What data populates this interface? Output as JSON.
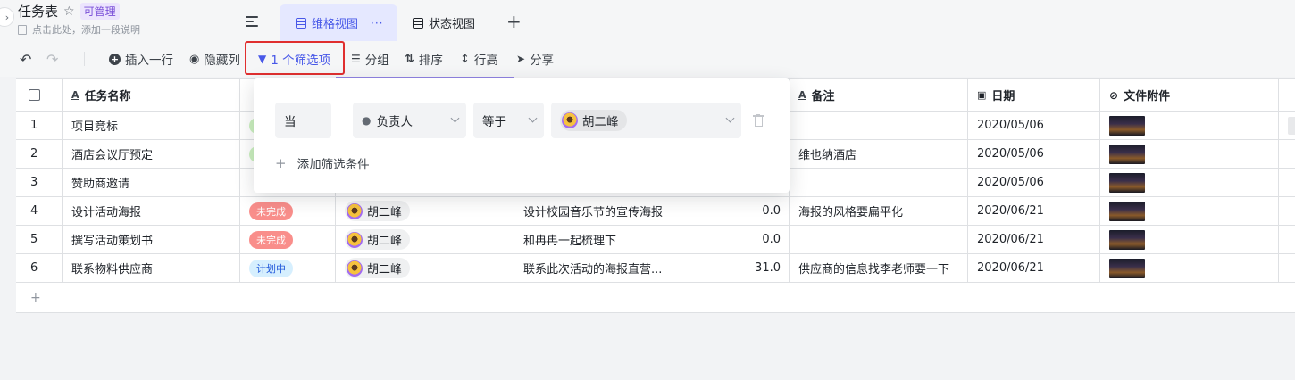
{
  "header": {
    "title": "任务表",
    "badge": "可管理",
    "description": "点击此处，添加一段说明",
    "views": [
      {
        "label": "维格视图",
        "active": true,
        "icon": "grid-icon",
        "more": "···"
      },
      {
        "label": "状态视图",
        "active": false,
        "icon": "grid-icon"
      }
    ],
    "add_view": "+"
  },
  "toolbar": {
    "undo": "↶",
    "redo": "↷",
    "insert_row": "插入一行",
    "hide_col": "隐藏列",
    "filter": "1 个筛选项",
    "group": "分组",
    "sort": "排序",
    "row_height": "行高",
    "share": "分享"
  },
  "table": {
    "columns": {
      "name": "任务名称",
      "note": "备注",
      "date": "日期",
      "attachment": "文件附件"
    },
    "rows": [
      {
        "num": "1",
        "name": "项目竞标",
        "status": "",
        "status_color": "green",
        "person": "",
        "desc": "",
        "amount": "",
        "note": "",
        "date": "2020/05/06"
      },
      {
        "num": "2",
        "name": "酒店会议厅预定",
        "status": "",
        "status_color": "green",
        "person": "",
        "desc": "",
        "amount": "",
        "note": "维也纳酒店",
        "date": "2020/05/06"
      },
      {
        "num": "3",
        "name": "赞助商邀请",
        "status": "",
        "status_color": "",
        "person": "",
        "desc": "",
        "amount": "",
        "note": "",
        "date": "2020/05/06"
      },
      {
        "num": "4",
        "name": "设计活动海报",
        "status": "未完成",
        "status_color": "red",
        "person": "胡二峰",
        "desc": "设计校园音乐节的宣传海报",
        "amount": "0.0",
        "note": "海报的风格要扁平化",
        "date": "2020/06/21"
      },
      {
        "num": "5",
        "name": "撰写活动策划书",
        "status": "未完成",
        "status_color": "red",
        "person": "胡二峰",
        "desc": "和冉冉一起梳理下",
        "amount": "0.0",
        "note": "",
        "date": "2020/06/21"
      },
      {
        "num": "6",
        "name": "联系物料供应商",
        "status": "计划中",
        "status_color": "blue",
        "person": "胡二峰",
        "desc": "联系此次活动的海报直营...",
        "amount": "31.0",
        "note": "供应商的信息找李老师要一下",
        "date": "2020/06/21"
      }
    ],
    "add_row": "+"
  },
  "filter_popover": {
    "conjunction": "当",
    "field": "负责人",
    "operator": "等于",
    "value": "胡二峰",
    "add_condition": "添加筛选条件"
  },
  "colors": {
    "accent": "#4858e8",
    "filter_highlight": "#e02f2f",
    "tag_red": "#f98e8b",
    "tag_blue": "#d6effe"
  }
}
